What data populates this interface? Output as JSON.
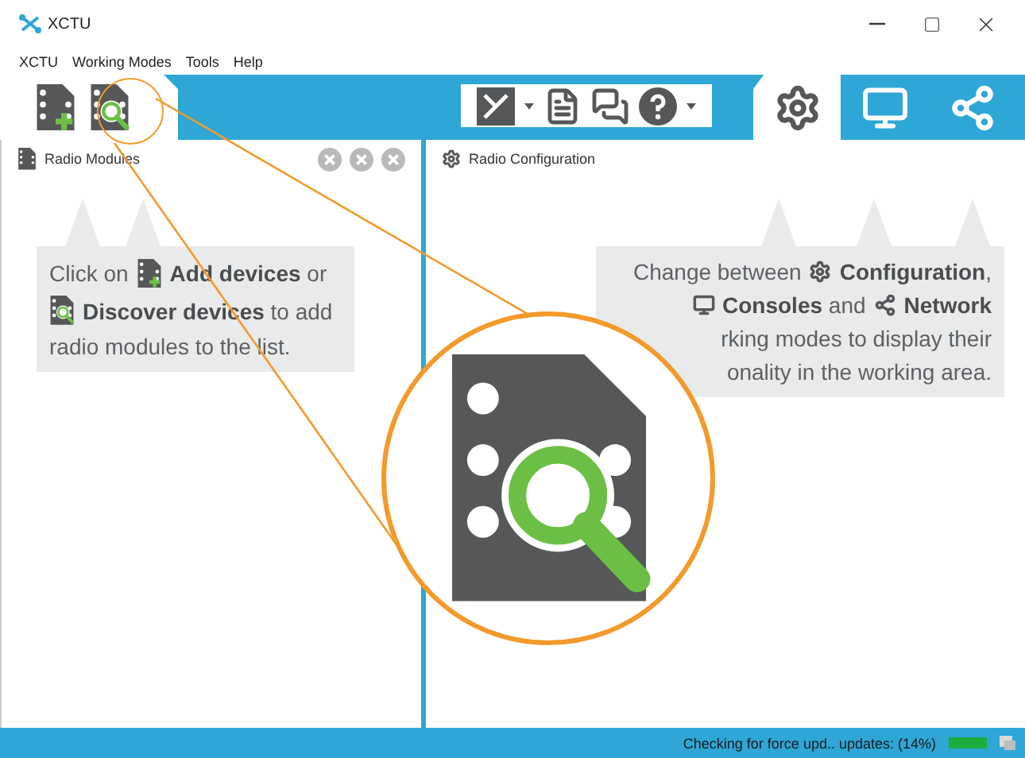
{
  "window": {
    "title": "XCTU"
  },
  "menu": [
    "XCTU",
    "Working Modes",
    "Tools",
    "Help"
  ],
  "device_tools": [
    {
      "kind": "add"
    },
    {
      "kind": "discover"
    }
  ],
  "mode_tabs": [
    {
      "kind": "configuration",
      "selected": true
    },
    {
      "kind": "consoles",
      "selected": false
    },
    {
      "kind": "network",
      "selected": false
    }
  ],
  "left_panel": {
    "title": "Radio Modules",
    "hint": [
      [
        {
          "kind": "text",
          "text": "Click on"
        },
        {
          "kind": "add"
        },
        {
          "kind": "text",
          "text": "**Add devices** or"
        }
      ],
      [
        {
          "kind": "discover"
        },
        {
          "kind": "text",
          "text": "**Discover devices** to add"
        }
      ],
      [
        {
          "kind": "text",
          "text": "radio modules to the list."
        }
      ]
    ]
  },
  "right_panel": {
    "title": "Radio Configuration",
    "hint": [
      [
        {
          "kind": "text",
          "text": "Change between"
        },
        {
          "kind": "gear"
        },
        {
          "kind": "text",
          "text": "**Configuration**,"
        }
      ],
      [
        {
          "kind": "console"
        },
        {
          "kind": "text",
          "text": "**Consoles** and"
        },
        {
          "kind": "network"
        },
        {
          "kind": "text",
          "text": "**Network**"
        }
      ],
      [
        {
          "kind": "text",
          "text": "rking modes to display their"
        }
      ],
      [
        {
          "kind": "text",
          "text": "onality in the working area."
        }
      ]
    ]
  },
  "status_bar": {
    "text": "Checking for force upd.. updates: (14%)",
    "level": 1
  }
}
